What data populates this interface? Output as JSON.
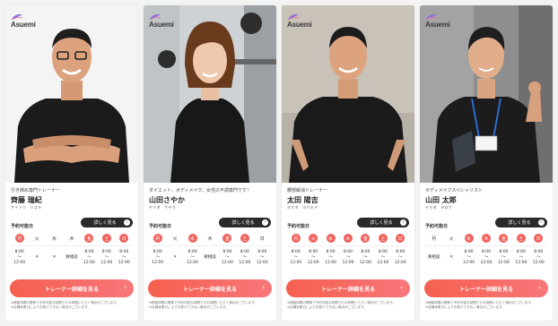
{
  "brand": "Asuemi",
  "colors": {
    "accent": "#f0625c",
    "button_dark": "#2a2a2a"
  },
  "cards": [
    {
      "catch": "引き締め専門トレーナー",
      "name": "齊藤 瑞紀",
      "kana": "サイトウ　ミズキ",
      "more": "詳しく見る",
      "schedule_label": "予約可能日",
      "days": [
        {
          "d": "月",
          "on": true,
          "t": "8:00\n〜\n12:00"
        },
        {
          "d": "火",
          "on": false,
          "t": "✕"
        },
        {
          "d": "水",
          "on": false,
          "t": "✕"
        },
        {
          "d": "木",
          "on": false,
          "t": "要相談"
        },
        {
          "d": "金",
          "on": true,
          "t": "8:00\n〜\n12:00"
        },
        {
          "d": "土",
          "on": true,
          "t": "8:00\n〜\n12:00"
        },
        {
          "d": "日",
          "on": true,
          "t": "8:00\n〜\n12:00"
        }
      ],
      "cta": "トレーナー詳細を見る",
      "note": "※移動時間の関係で予約可能な時間でもお時間いただく場合がございます。\n※店舗休業日によりお受けできない場合がございます。"
    },
    {
      "catch": "ダイエット、ボディメイク、女性の不調専門です！",
      "name": "山田さやか",
      "kana": "ヤマダ　サヤカ",
      "more": "詳しく見る",
      "schedule_label": "予約可能日",
      "days": [
        {
          "d": "月",
          "on": true,
          "t": "8:00\n〜\n12:00"
        },
        {
          "d": "火",
          "on": false,
          "t": "✕"
        },
        {
          "d": "水",
          "on": true,
          "t": "8:00\n〜\n12:00"
        },
        {
          "d": "木",
          "on": false,
          "t": "要相談"
        },
        {
          "d": "金",
          "on": true,
          "t": "8:00\n〜\n12:00"
        },
        {
          "d": "土",
          "on": true,
          "t": "8:00\n〜\n12:00"
        },
        {
          "d": "日",
          "on": false,
          "t": "8:00\n〜\n12:00"
        }
      ],
      "cta": "トレーナー詳細を見る",
      "note": "※移動時間の関係で予約可能な時間でもお時間いただく場合がございます。\n※店舗休業日によりお受けできない場合がございます。"
    },
    {
      "catch": "腰部解消トレーナー",
      "name": "太田 陽吉",
      "kana": "オオタ　ヨウキチ",
      "more": "詳しく見る",
      "schedule_label": "予約可能日",
      "days": [
        {
          "d": "月",
          "on": true,
          "t": "8:00\n〜\n12:00"
        },
        {
          "d": "火",
          "on": true,
          "t": "8:00\n〜\n12:00"
        },
        {
          "d": "水",
          "on": true,
          "t": "8:00\n〜\n12:00"
        },
        {
          "d": "木",
          "on": true,
          "t": "8:00\n〜\n12:00"
        },
        {
          "d": "金",
          "on": true,
          "t": "8:00\n〜\n12:00"
        },
        {
          "d": "土",
          "on": true,
          "t": "8:00\n〜\n12:00"
        },
        {
          "d": "日",
          "on": true,
          "t": "8:00\n〜\n12:00"
        }
      ],
      "cta": "トレーナー詳細を見る",
      "note": "※移動時間の関係で予約可能な時間でもお時間いただく場合がございます。\n※店舗休業日によりお受けできない場合がございます。"
    },
    {
      "catch": "ボディメイクスペシャリスト",
      "name": "山田 太郎",
      "kana": "ヤマダ　タロウ",
      "more": "詳しく見る",
      "schedule_label": "予約可能日",
      "days": [
        {
          "d": "月",
          "on": false,
          "t": "要相談"
        },
        {
          "d": "火",
          "on": false,
          "t": "✕"
        },
        {
          "d": "水",
          "on": true,
          "t": "8:00\n〜\n12:00"
        },
        {
          "d": "木",
          "on": true,
          "t": "8:00\n〜\n12:00"
        },
        {
          "d": "金",
          "on": true,
          "t": "8:00\n〜\n12:00"
        },
        {
          "d": "土",
          "on": true,
          "t": "8:00\n〜\n12:00"
        },
        {
          "d": "日",
          "on": true,
          "t": "8:00\n〜\n12:00"
        }
      ],
      "cta": "トレーナー詳細を見る",
      "note": "※移動時間の関係で予約可能な時間でもお時間いただく場合がございます。\n※店舗休業日によりお受けできない場合がございます。"
    }
  ]
}
